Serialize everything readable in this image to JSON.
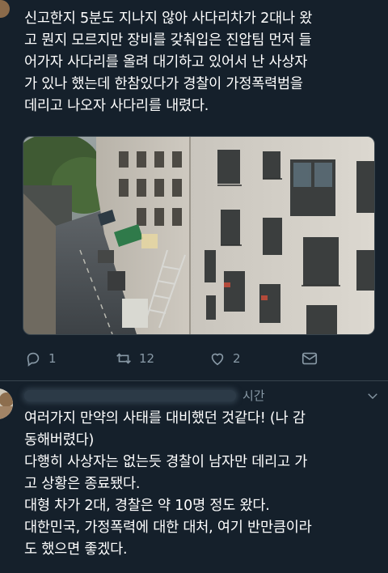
{
  "tweet": {
    "text": "신고한지 5분도 지나지 않아 사다리차가 2대나 왔\n고 뭔지 모르지만 장비를 갖춰입은 진압팀 먼저 들\n어가자 사다리를 올려 대기하고 있어서 난 사상자\n가 있나 했는데 한참있다가 경찰이 가정폭력범을\n데리고 나오자 사다리를 내렸다.",
    "reply_count": "1",
    "retweet_count": "12",
    "like_count": "2",
    "icons": [
      "reply-icon",
      "retweet-icon",
      "like-icon",
      "dm-icon"
    ]
  },
  "reply": {
    "time": "시간",
    "text": "여러가지 만약의 사태를 대비했던 것같다! (나 감\n동해버렸다)\n다행히 사상자는 없는듯 경찰이 남자만 데리고 가\n고 상황은 종료됐다.\n대형 차가 2대, 경찰은 약 10명 정도 왔다.\n대한민국, 가정폭력에 대한 대처, 여기 반만큼이라\n도 했으면 좋겠다."
  },
  "colors": {
    "background": "#15202b",
    "text": "#ffffff",
    "secondary": "#8899a6",
    "border": "#38444d"
  }
}
